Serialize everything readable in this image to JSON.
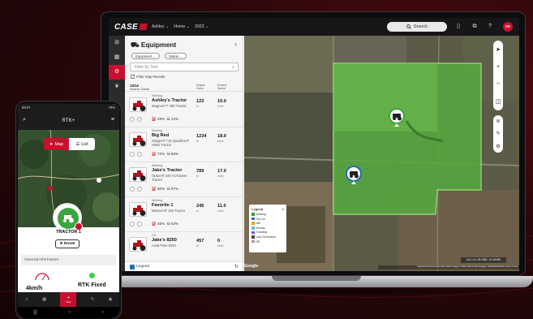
{
  "header": {
    "brand": "CASE",
    "user_menu": "Ashley ⌄",
    "home_menu": "Home ⌄",
    "year_menu": "2023 ⌄",
    "search_label": "Search",
    "avatar_initials": "CK"
  },
  "panel": {
    "title": "Equipment",
    "chip_equipment": "Equipment ⌄",
    "chip_status": "Status ⌄",
    "filter_placeholder": "Filter by Text",
    "filter_checkbox": "Filter Map Results",
    "count": "10/12",
    "count_sub": "Machine Details",
    "col_engine": "Engine Hours",
    "col_speed": "Ground Speed",
    "legend_label": "Legend",
    "cards": [
      {
        "status": "Working",
        "name": "Ashley's Tractor",
        "model": "Magnum™ 380 Tractor",
        "engine": "123",
        "engine_unit": "hr",
        "speed": "10.0",
        "speed_unit": "km/h",
        "fuel": "29%",
        "def": "12%"
      },
      {
        "status": "Working",
        "name": "Big Red",
        "model": "Steiger® 715 Quadtrac® HWD Tractor",
        "engine": "1234",
        "engine_unit": "hr",
        "speed": "18.0",
        "speed_unit": "km/h",
        "fuel": "73%",
        "def": "66%"
      },
      {
        "status": "Working",
        "name": "Jake's Tractor",
        "model": "Optum® 340 CVXDrive Tractor",
        "engine": "789",
        "engine_unit": "hr",
        "speed": "17.0",
        "speed_unit": "km/h",
        "fuel": "50%",
        "def": "57%"
      },
      {
        "status": "Working",
        "name": "Favorite 1",
        "model": "Maxxum® 150 Tractor",
        "engine": "245",
        "engine_unit": "hr",
        "speed": "11.0",
        "speed_unit": "km/h",
        "fuel": "45%",
        "def": "52%"
      },
      {
        "status": "Off",
        "name": "Jake's 8250",
        "model": "Axial-Flow 8250",
        "engine": "457",
        "engine_unit": "hr",
        "speed": "0",
        "speed_unit": "km/h"
      }
    ]
  },
  "map": {
    "legend_title": "Legend",
    "legend_items": [
      {
        "label": "Working",
        "color": "#2e9e3a"
      },
      {
        "label": "Key On",
        "color": "#1f6fbf"
      },
      {
        "label": "Idle",
        "color": "#f2a900"
      },
      {
        "label": "Moving",
        "color": "#5bc0eb"
      },
      {
        "label": "Traveling",
        "color": "#7c4dbf"
      },
      {
        "label": "Lost Connection",
        "color": "#444444"
      },
      {
        "label": "Off",
        "color": "#9e9e9e"
      }
    ],
    "coords": "Lat, Lon: 39.4382, -91.81956",
    "attribution": "Keyboard shortcuts  Map data ©2023 Imagery ©2023, Maxar Technologies, USDA/FPAC/GEO  Terms of Use",
    "google": "Google"
  },
  "phone": {
    "time": "08:57",
    "battery": "75%",
    "title": "RTK+",
    "toggle_map": "Map",
    "toggle_list": "List",
    "tractor_name": "TRACTOR 1",
    "route_label": "Route",
    "general_info": "General information",
    "speed_value": "4km/h",
    "rtk_status": "RTK Fixed",
    "nav_map": "Map"
  },
  "colors": {
    "brand_red": "#c8102e",
    "field_green": "#4a9e3c"
  }
}
